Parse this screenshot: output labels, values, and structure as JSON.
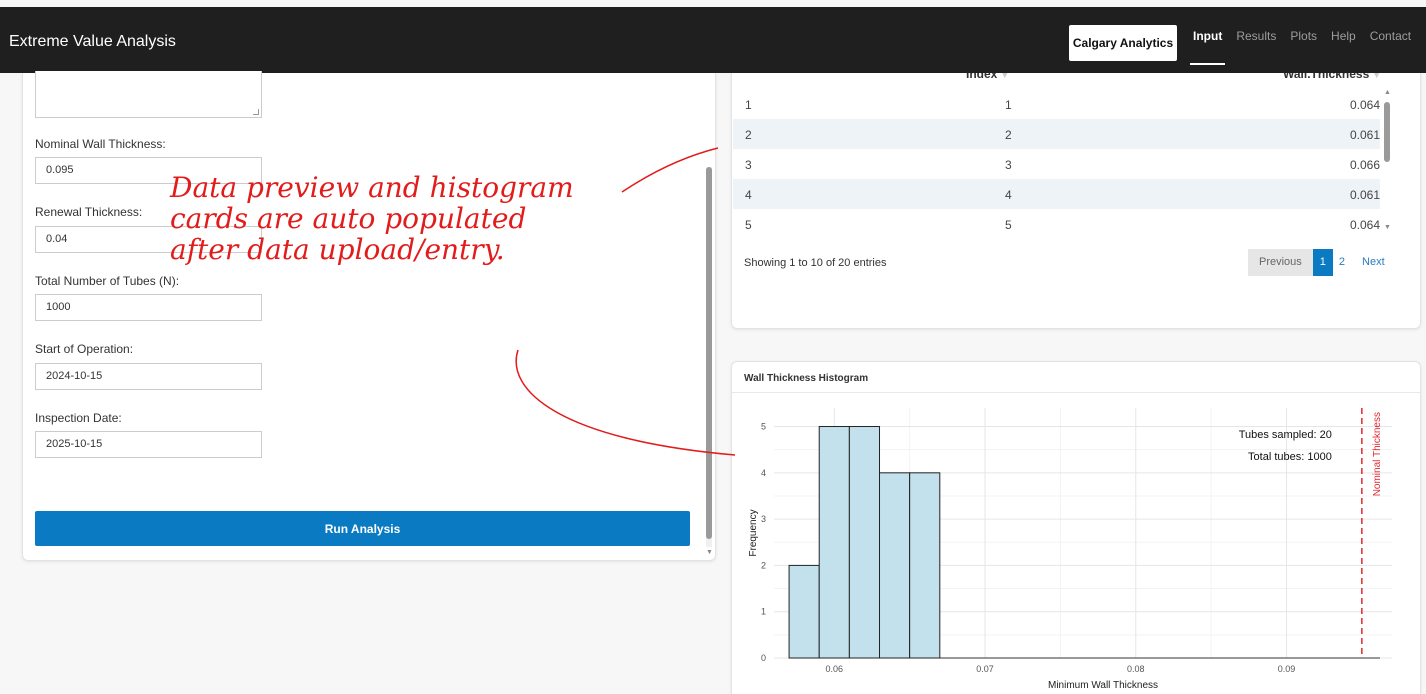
{
  "app": {
    "title": "Extreme Value Analysis",
    "logo_text": "Calgary Analytics",
    "nav": [
      "Input",
      "Results",
      "Plots",
      "Help",
      "Contact"
    ],
    "active_nav": "Input"
  },
  "form": {
    "fields": [
      {
        "label": "Nominal Wall Thickness:",
        "value": "0.095"
      },
      {
        "label": "Renewal Thickness:",
        "value": "0.04"
      },
      {
        "label": "Total Number of Tubes (N):",
        "value": "1000"
      },
      {
        "label": "Start of Operation:",
        "value": "2024-10-15"
      },
      {
        "label": "Inspection Date:",
        "value": "2025-10-15"
      }
    ],
    "run_button": "Run Analysis"
  },
  "table": {
    "columns": [
      "Index",
      "Wall.Thickness"
    ],
    "rows": [
      [
        "1",
        "1",
        "0.064"
      ],
      [
        "2",
        "2",
        "0.061"
      ],
      [
        "3",
        "3",
        "0.066"
      ],
      [
        "4",
        "4",
        "0.061"
      ],
      [
        "5",
        "5",
        "0.064"
      ]
    ],
    "info": "Showing 1 to 10 of 20 entries",
    "pager": {
      "previous": "Previous",
      "pages": [
        "1",
        "2"
      ],
      "current": "1",
      "next": "Next"
    }
  },
  "histogram": {
    "card_title": "Wall Thickness Histogram",
    "annotations": [
      "Tubes sampled: 20",
      "Total tubes: 1000"
    ],
    "nominal_label": "Nominal Thickness",
    "line_color": "#e0282e",
    "bar_color": "#c3e1ec"
  },
  "chart_data": {
    "type": "bar",
    "xlabel": "Minimum Wall Thickness",
    "ylabel": "Frequency",
    "bins": [
      {
        "from": 0.057,
        "to": 0.059,
        "count": 2
      },
      {
        "from": 0.059,
        "to": 0.061,
        "count": 5
      },
      {
        "from": 0.061,
        "to": 0.063,
        "count": 5
      },
      {
        "from": 0.063,
        "to": 0.065,
        "count": 4
      },
      {
        "from": 0.065,
        "to": 0.067,
        "count": 4
      }
    ],
    "xticks": [
      "0.06",
      "0.07",
      "0.08",
      "0.09"
    ],
    "yticks": [
      "0",
      "1",
      "2",
      "3",
      "4",
      "5"
    ],
    "xlim": [
      0.056,
      0.097
    ],
    "ylim": [
      0,
      5.4
    ],
    "nominal_thickness": 0.095,
    "grid": true
  },
  "annotation": {
    "text": "Data preview and histogram cards are auto populated after data upload/entry.",
    "color": "#e21b1b"
  }
}
